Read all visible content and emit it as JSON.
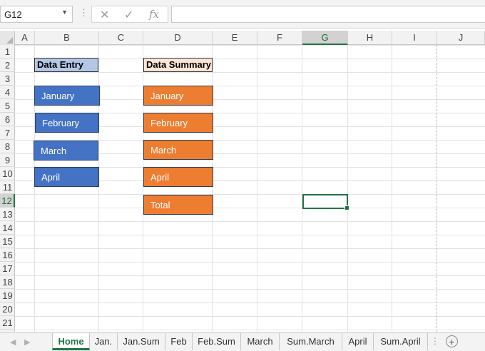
{
  "formula_bar": {
    "name_box": "G12",
    "cancel_glyph": "✕",
    "enter_glyph": "✓",
    "function_glyph": "fx",
    "formula_value": ""
  },
  "columns": [
    "A",
    "B",
    "C",
    "D",
    "E",
    "F",
    "G",
    "H",
    "I",
    "J"
  ],
  "rows": [
    "1",
    "2",
    "3",
    "4",
    "5",
    "6",
    "7",
    "8",
    "9",
    "10",
    "11",
    "12",
    "13",
    "14",
    "15",
    "16",
    "17",
    "18",
    "19",
    "20",
    "21"
  ],
  "selected": {
    "column": "G",
    "row": "12"
  },
  "labels": {
    "data_entry": "Data Entry",
    "data_summary": "Data Summary"
  },
  "entry_buttons": [
    "January",
    "February",
    "March",
    "April"
  ],
  "summary_buttons": [
    "January",
    "February",
    "March",
    "April",
    "Total"
  ],
  "sheet_tabs": [
    "Home",
    "Jan.",
    "Jan.Sum",
    "Feb",
    "Feb.Sum",
    "March",
    "Sum.March",
    "April",
    "Sum.April"
  ],
  "active_tab": "Home",
  "colors": {
    "entry_button": "#4472c4",
    "summary_button": "#ed7d31",
    "data_entry_label_bg": "#b4c7e7",
    "data_summary_label_bg": "#fbe5d6",
    "accent": "#217346"
  }
}
